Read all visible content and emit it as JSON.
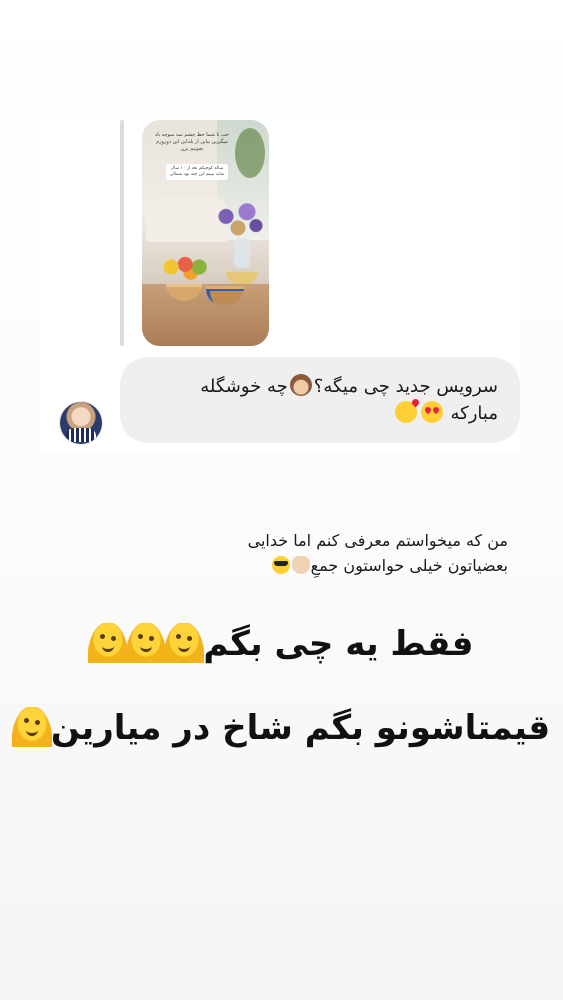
{
  "story_reply": {
    "image_text": "خب تا شما خط چشم نمه سوچه باد میگیرین بیاین از یلدایی این دوروزم بخونیم بزن",
    "image_sticker": "ساله کوچیکم بعد از ۱۰ سال شاید ببینم این چند بود شمالی"
  },
  "message": {
    "line1": "سرویس جدید چی میگه؟",
    "line1_end": "چه خوشگله",
    "line2": "مبارکه",
    "emojis": [
      "monkey-see-no-evil-emoji",
      "heart-eyes-emoji",
      "kissing-heart-emoji"
    ]
  },
  "caption": {
    "line1": "من که میخواستم معرفی کنم اما خدایی",
    "line2": "بعضیاتون خیلی حواستون جمعِ"
  },
  "headline": {
    "line1": "فقط یه چی بگم",
    "line2": "قیمتاشونو بگم شاخ در میارین"
  },
  "colors": {
    "bubble": "#efeff0",
    "text": "#1a1a1a",
    "emoji_yellow": "#ffd43b"
  }
}
